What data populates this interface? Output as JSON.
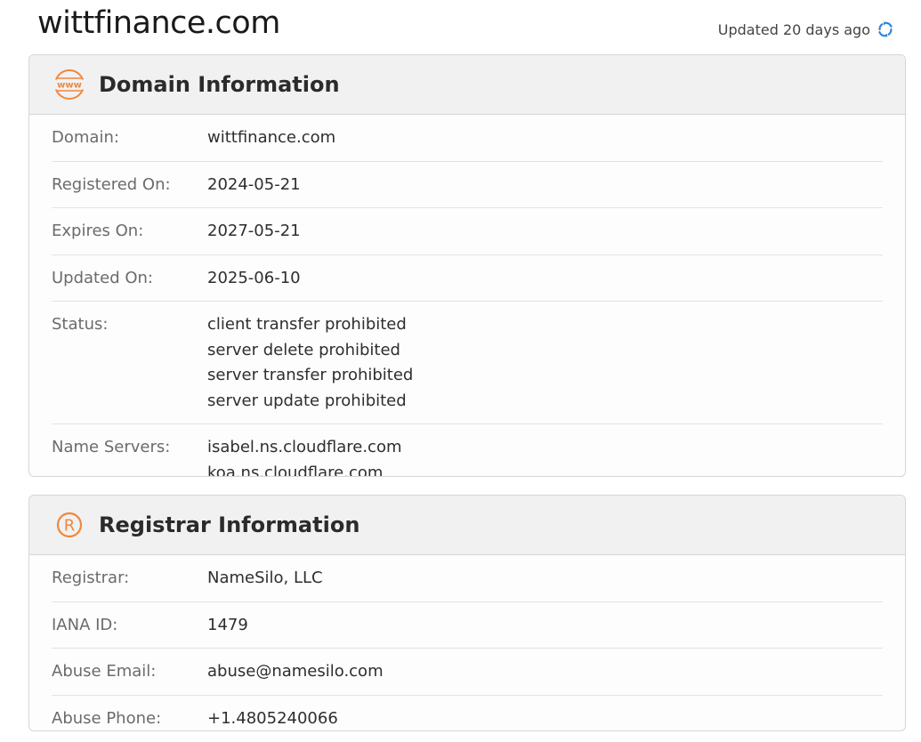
{
  "site_title": "wittfinance.com",
  "updated_text": "Updated 20 days ago",
  "colors": {
    "accent_orange": "#f0883e",
    "refresh_blue": "#2e86de"
  },
  "domain_card": {
    "icon": "www-icon",
    "title": "Domain Information",
    "rows": [
      {
        "label": "Domain:",
        "values": [
          "wittfinance.com"
        ]
      },
      {
        "label": "Registered On:",
        "values": [
          "2024-05-21"
        ]
      },
      {
        "label": "Expires On:",
        "values": [
          "2027-05-21"
        ]
      },
      {
        "label": "Updated On:",
        "values": [
          "2025-06-10"
        ]
      },
      {
        "label": "Status:",
        "values": [
          "client transfer prohibited",
          "server delete prohibited",
          "server transfer prohibited",
          "server update prohibited"
        ]
      },
      {
        "label": "Name Servers:",
        "values": [
          "isabel.ns.cloudflare.com",
          "koa.ns.cloudflare.com"
        ]
      }
    ]
  },
  "registrar_card": {
    "icon": "registered-icon",
    "title": "Registrar Information",
    "rows": [
      {
        "label": "Registrar:",
        "values": [
          "NameSilo, LLC"
        ]
      },
      {
        "label": "IANA ID:",
        "values": [
          "1479"
        ]
      },
      {
        "label": "Abuse Email:",
        "values": [
          "abuse@namesilo.com"
        ]
      },
      {
        "label": "Abuse Phone:",
        "values": [
          "+1.4805240066"
        ]
      }
    ]
  }
}
